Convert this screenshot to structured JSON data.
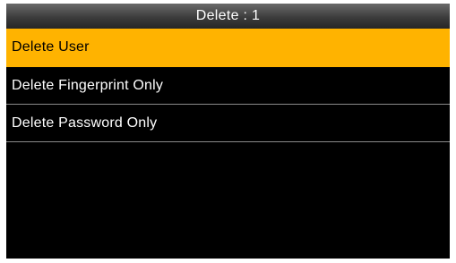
{
  "title_bar": {
    "title": "Delete : 1"
  },
  "menu": {
    "items": [
      {
        "label": "Delete User",
        "selected": true
      },
      {
        "label": "Delete Fingerprint Only",
        "selected": false
      },
      {
        "label": "Delete Password Only",
        "selected": false
      }
    ]
  },
  "colors": {
    "selection_highlight": "#ffb300",
    "background": "#000000",
    "text": "#ffffff",
    "divider": "#8a8a8a"
  }
}
